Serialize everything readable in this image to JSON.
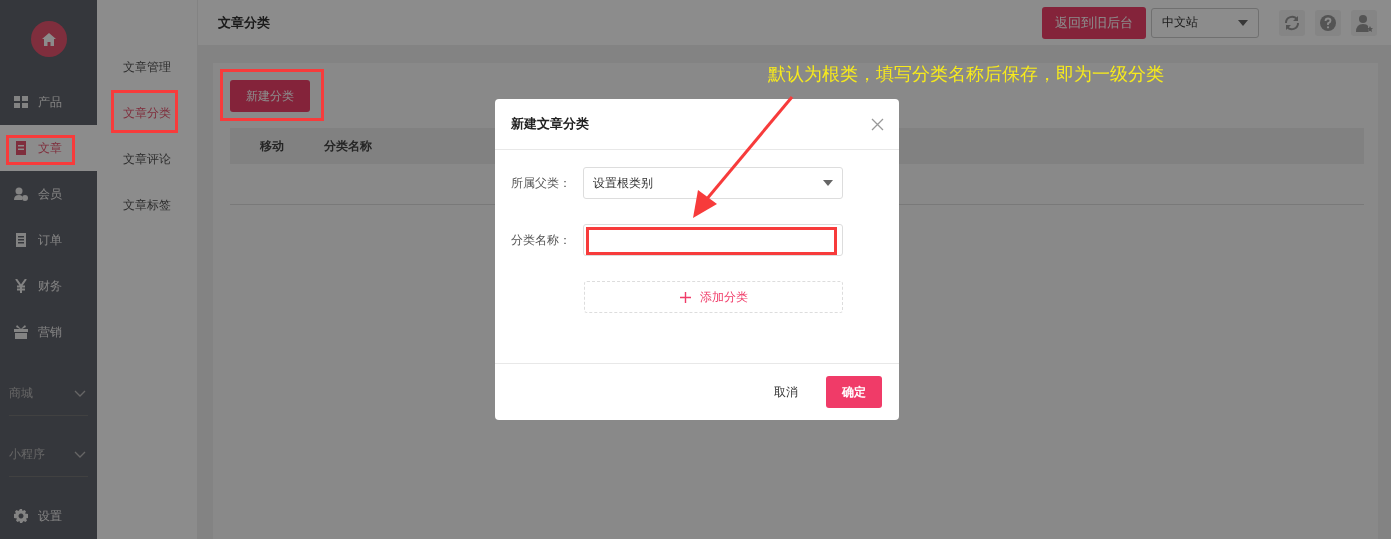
{
  "sidebar": {
    "items": [
      {
        "label": "产品",
        "kind": "grid",
        "selected": false
      },
      {
        "label": "文章",
        "kind": "doc",
        "selected": true
      },
      {
        "label": "会员",
        "kind": "user",
        "selected": false
      },
      {
        "label": "订单",
        "kind": "list",
        "selected": false
      },
      {
        "label": "财务",
        "kind": "yen",
        "selected": false
      },
      {
        "label": "营销",
        "kind": "gift",
        "selected": false
      }
    ],
    "groups": [
      {
        "label": "商城"
      },
      {
        "label": "小程序"
      }
    ],
    "footer": {
      "label": "设置"
    }
  },
  "subnav": [
    {
      "label": "文章管理",
      "selected": false
    },
    {
      "label": "文章分类",
      "selected": true
    },
    {
      "label": "文章评论",
      "selected": false
    },
    {
      "label": "文章标签",
      "selected": false
    }
  ],
  "header": {
    "title": "文章分类",
    "back_button": "返回到旧后台",
    "site_select": "中文站"
  },
  "toolbar": {
    "new_button": "新建分类"
  },
  "table": {
    "columns": [
      "移动",
      "分类名称"
    ]
  },
  "dialog": {
    "title": "新建文章分类",
    "fields": [
      {
        "label": "所属父类：",
        "kind": "select",
        "value": "设置根类别"
      },
      {
        "label": "分类名称：",
        "kind": "input"
      }
    ],
    "add_button": "添加分类",
    "cancel": "取消",
    "ok": "确定"
  },
  "annotation": {
    "text": "默认为根类，填写分类名称后保存，即为一级分类"
  }
}
